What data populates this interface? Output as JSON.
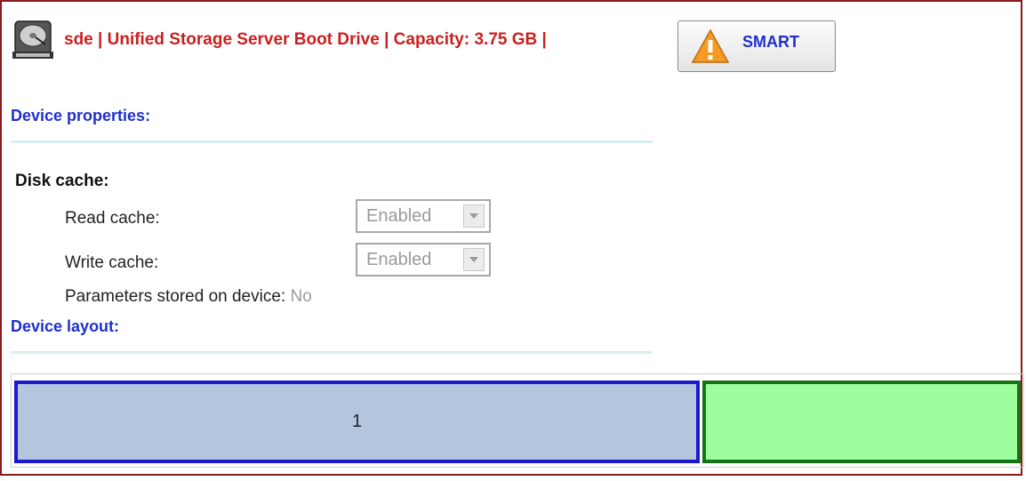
{
  "header": {
    "title": "sde  |  Unified Storage Server Boot Drive  |  Capacity: 3.75 GB |",
    "drive_icon": "hard-drive-icon",
    "smart_label": "SMART",
    "smart_icon": "warning-icon"
  },
  "device_properties": {
    "title": "Device properties:",
    "disk_cache_title": "Disk cache:",
    "read_cache": {
      "label": "Read cache:",
      "value": "Enabled"
    },
    "write_cache": {
      "label": "Write cache:",
      "value": "Enabled"
    },
    "params_label": "Parameters stored on device:",
    "params_value": "No"
  },
  "device_layout": {
    "title": "Device layout:",
    "partitions": [
      {
        "label": "1",
        "color": "#b4c6de",
        "border": "#1a1acc"
      },
      {
        "label": "",
        "color": "#9efd9e",
        "border": "#157515"
      }
    ]
  },
  "colors": {
    "frame": "#8b1a1a",
    "title_red": "#cc1f1f",
    "section_blue": "#1f2fd0"
  }
}
